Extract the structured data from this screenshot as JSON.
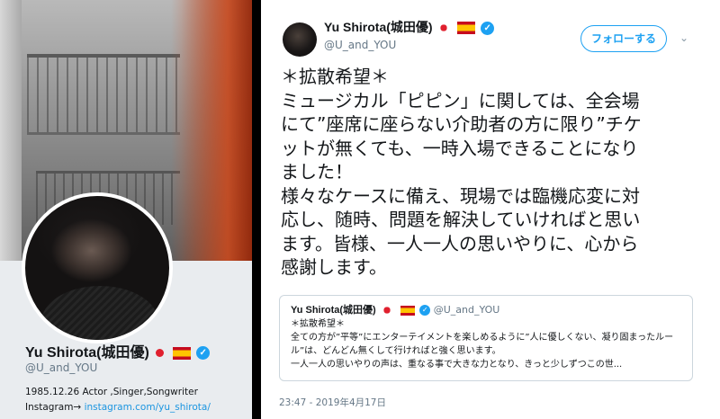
{
  "profile": {
    "name": "Yu Shirota(城田優)",
    "handle": "@U_and_YOU",
    "bio_line1": "1985.12.26 Actor ,Singer,Songwriter",
    "bio_prefix": "Instagram→ ",
    "bio_link": "instagram.com/yu_shirota/"
  },
  "tweet": {
    "author_name": "Yu Shirota(城田優)",
    "author_handle": "@U_and_YOU",
    "follow_label": "フォローする",
    "caret_icon": "chevron-down-icon",
    "lines": [
      "＊拡散希望＊",
      "ミュージカル「ピピン」に関しては、全会場",
      "にて”座席に座らない介助者の方に限り”チケ",
      "ットが無くても、一時入場できることになり",
      "ました！",
      "様々なケースに備え、現場では臨機応変に対",
      "応し、随時、問題を解決していければと思い",
      "ます。皆様、一人一人の思いやりに、心から",
      "感謝します。"
    ],
    "timestamp": "23:47 - 2019年4月17日"
  },
  "quote": {
    "name": "Yu Shirota(城田優)",
    "handle": "@U_and_YOU",
    "lines": [
      "＊拡散希望＊",
      "全ての方が”平等”にエンターテイメントを楽しめるように”人に優しくない、凝り固まったルール”は、どんどん無くして行ければと強く思います。",
      "一人一人の思いやりの声は、重なる事で大きな力となり、きっと少しずつこの世..."
    ]
  },
  "colors": {
    "accent": "#1da1f2",
    "text": "#14171a",
    "muted": "#657786"
  }
}
